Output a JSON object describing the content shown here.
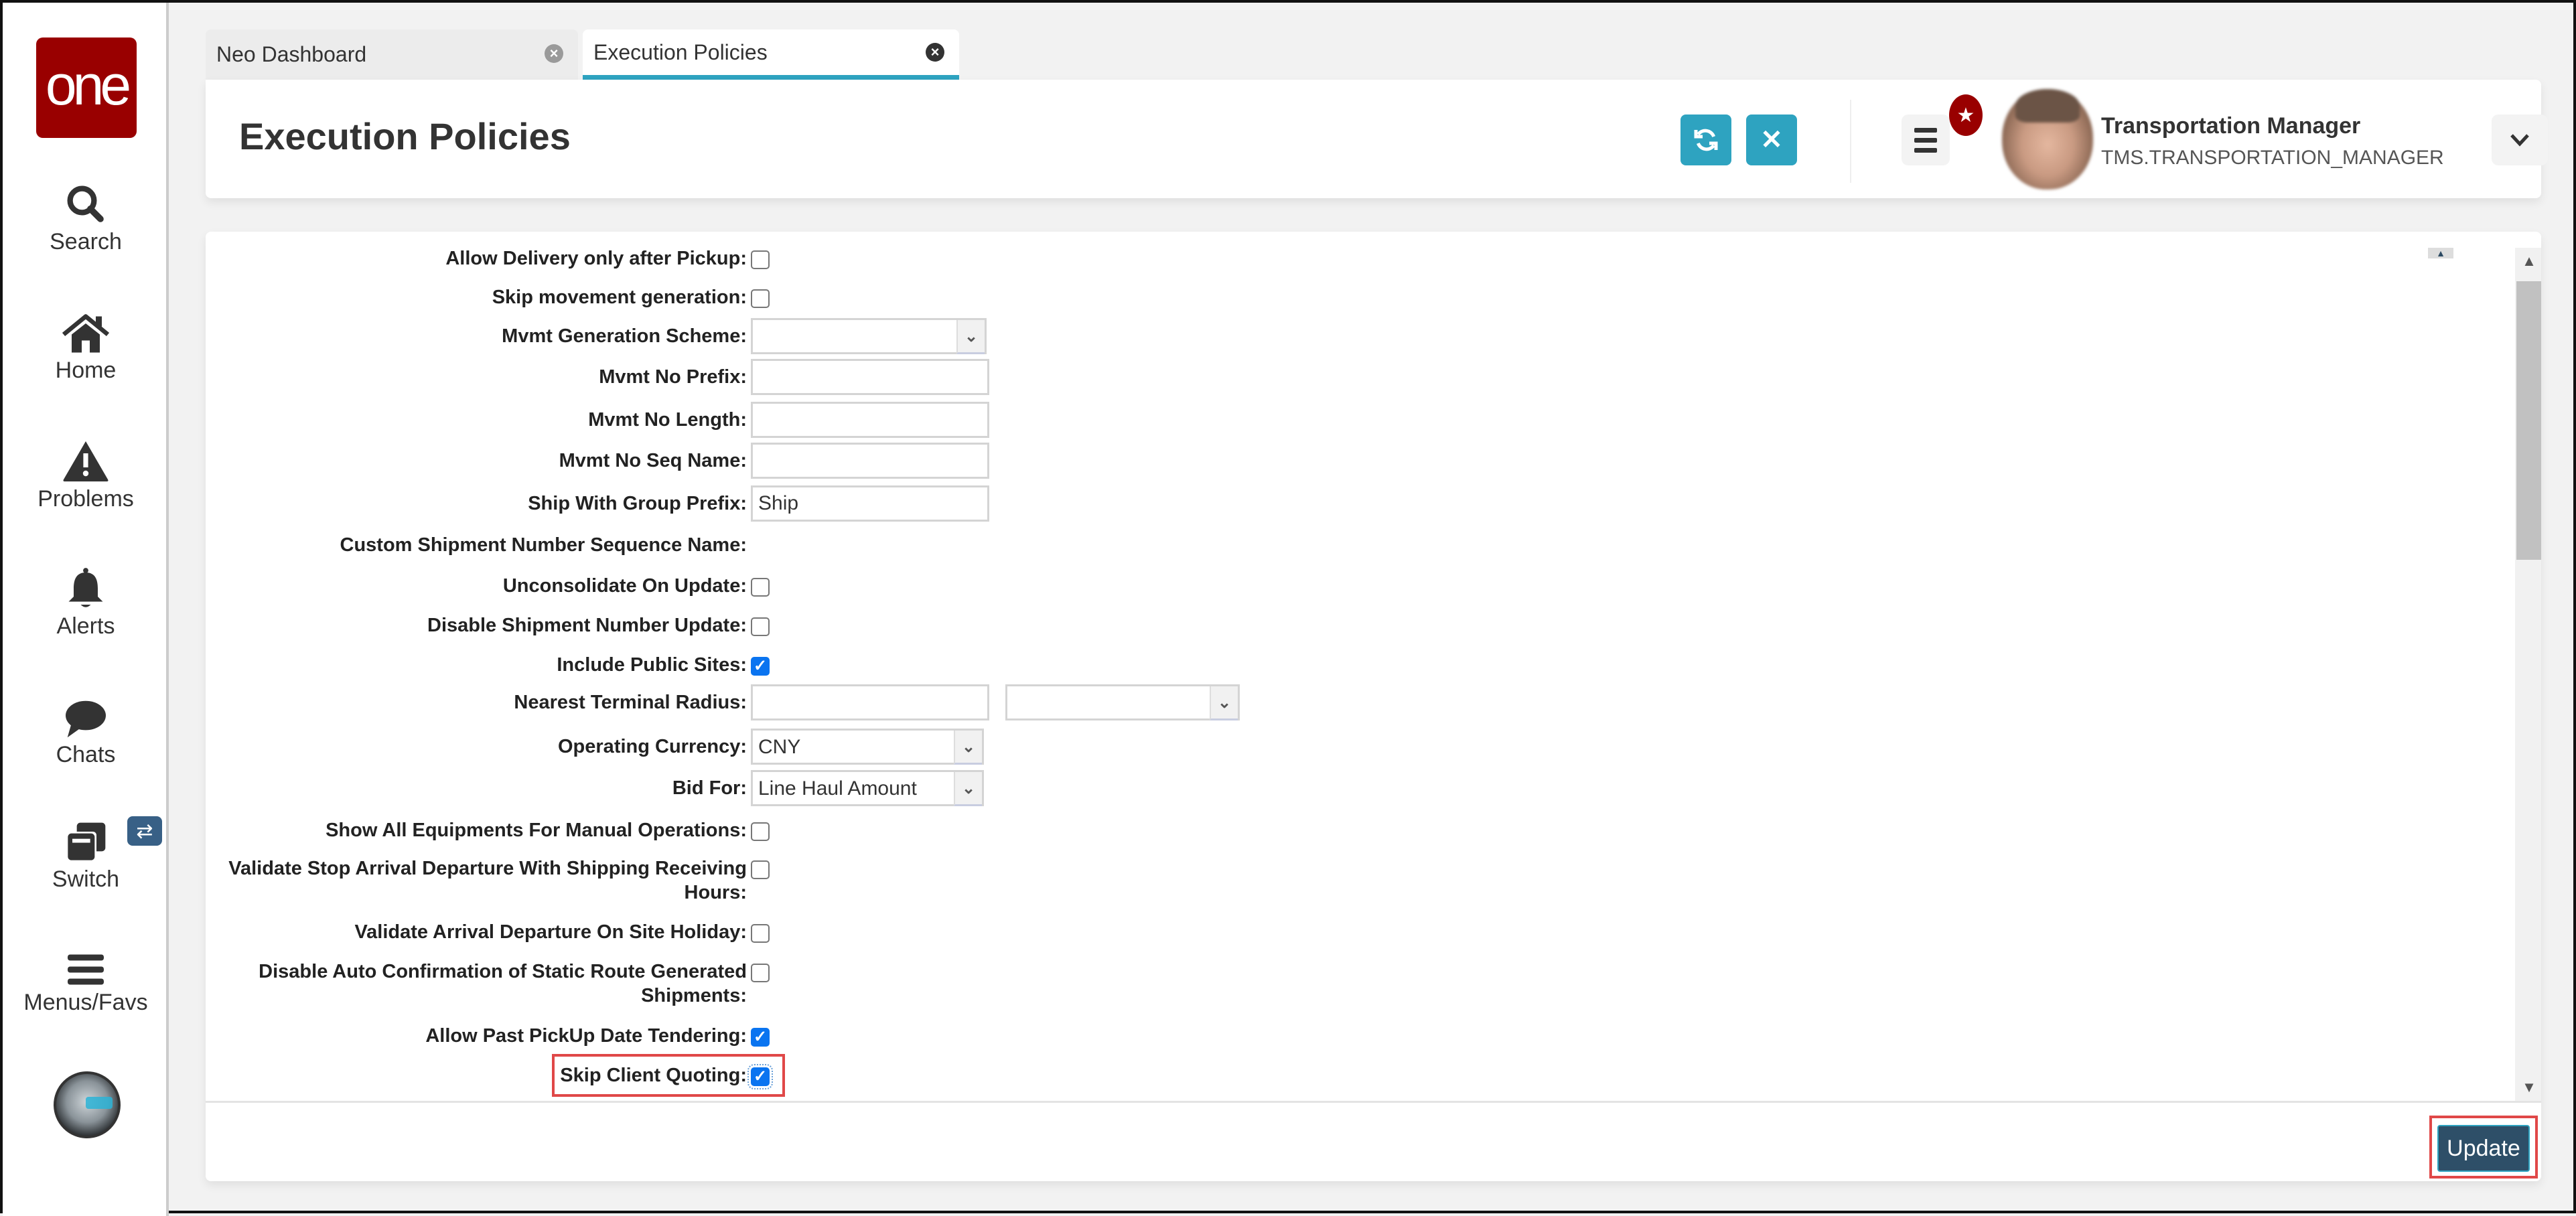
{
  "app": {
    "logo_text": "one",
    "brand_color": "#990000",
    "accent_color": "#2ea3c0"
  },
  "sidebar": {
    "items": [
      {
        "label": "Search",
        "icon": "search-icon"
      },
      {
        "label": "Home",
        "icon": "home-icon"
      },
      {
        "label": "Problems",
        "icon": "warning-icon"
      },
      {
        "label": "Alerts",
        "icon": "bell-icon"
      },
      {
        "label": "Chats",
        "icon": "chat-icon"
      },
      {
        "label": "Switch",
        "icon": "windows-icon"
      },
      {
        "label": "Menus/Favs",
        "icon": "hamburger-icon"
      }
    ],
    "switch_badge_icon": "swap-arrows-icon"
  },
  "tabs": [
    {
      "label": "Neo Dashboard",
      "active": false
    },
    {
      "label": "Execution Policies",
      "active": true
    }
  ],
  "header": {
    "title": "Execution Policies",
    "refresh_icon": "refresh-icon",
    "close_icon": "close-icon",
    "menu_icon": "hamburger-icon",
    "favorites_icon": "star-icon",
    "user": {
      "name": "Transportation Manager",
      "role": "TMS.TRANSPORTATION_MANAGER"
    }
  },
  "form": {
    "fields": [
      {
        "label": "Allow Delivery only after Pickup:",
        "type": "checkbox",
        "checked": false
      },
      {
        "label": "Skip movement generation:",
        "type": "checkbox",
        "checked": false
      },
      {
        "label": "Mvmt Generation Scheme:",
        "type": "select",
        "value": ""
      },
      {
        "label": "Mvmt No Prefix:",
        "type": "text",
        "value": ""
      },
      {
        "label": "Mvmt No Length:",
        "type": "text",
        "value": ""
      },
      {
        "label": "Mvmt No Seq Name:",
        "type": "text",
        "value": ""
      },
      {
        "label": "Ship With Group Prefix:",
        "type": "text",
        "value": "Ship"
      },
      {
        "label": "Custom Shipment Number Sequence Name:",
        "type": "none"
      },
      {
        "label": "Unconsolidate On Update:",
        "type": "checkbox",
        "checked": false
      },
      {
        "label": "Disable Shipment Number Update:",
        "type": "checkbox",
        "checked": false
      },
      {
        "label": "Include Public Sites:",
        "type": "checkbox",
        "checked": true
      },
      {
        "label": "Nearest Terminal Radius:",
        "type": "text+select",
        "value": "",
        "unit": ""
      },
      {
        "label": "Operating Currency:",
        "type": "select",
        "value": "CNY"
      },
      {
        "label": "Bid For:",
        "type": "select",
        "value": "Line Haul Amount"
      },
      {
        "label": "Show All Equipments For Manual Operations:",
        "type": "checkbox",
        "checked": false
      },
      {
        "label": "Validate Stop Arrival Departure With Shipping Receiving Hours:",
        "type": "checkbox",
        "checked": false
      },
      {
        "label": "Validate Arrival Departure On Site Holiday:",
        "type": "checkbox",
        "checked": false
      },
      {
        "label": "Disable Auto Confirmation of Static Route Generated Shipments:",
        "type": "checkbox",
        "checked": false
      },
      {
        "label": "Allow Past PickUp Date Tendering:",
        "type": "checkbox",
        "checked": true
      },
      {
        "label": "Skip Client Quoting:",
        "type": "checkbox",
        "checked": true,
        "highlighted": true
      }
    ]
  },
  "footer": {
    "update_label": "Update"
  }
}
